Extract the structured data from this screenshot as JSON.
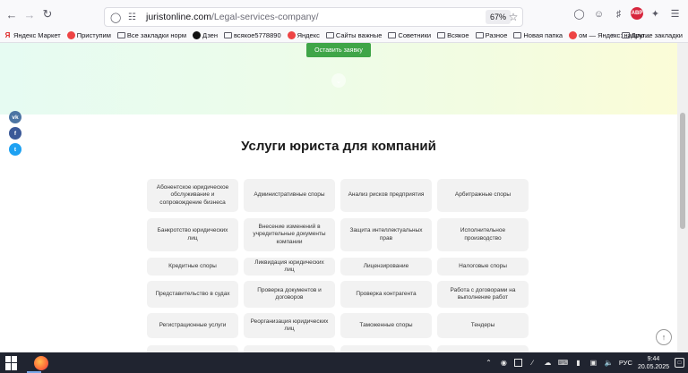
{
  "browser": {
    "url_domain": "juristonline.com",
    "url_path": "/Legal-services-company/",
    "zoom": "67%"
  },
  "bookmarks": {
    "items": [
      {
        "label": "Яндекс Маркет",
        "icon": "ya"
      },
      {
        "label": "Приступим",
        "icon": "red"
      },
      {
        "label": "Все закладки норм",
        "icon": "folder"
      },
      {
        "label": "Дзен",
        "icon": "dzen"
      },
      {
        "label": "всякое5778890",
        "icon": "folder"
      },
      {
        "label": "Яндекс",
        "icon": "red"
      },
      {
        "label": "Сайты важные",
        "icon": "folder"
      },
      {
        "label": "Советники",
        "icon": "folder"
      },
      {
        "label": "Всякое",
        "icon": "folder"
      },
      {
        "label": "Разное",
        "icon": "folder"
      },
      {
        "label": "Новая папка",
        "icon": "folder"
      },
      {
        "label": "ом — Яндекс: нашло...",
        "icon": "red"
      }
    ],
    "other": "Другие закладки"
  },
  "hero": {
    "cta_label": "Оставить заявку"
  },
  "social": {
    "vk": "vk",
    "fb": "f",
    "tw": "t"
  },
  "section": {
    "title": "Услуги юриста для компаний"
  },
  "services": [
    "Абонентское юридическое обслуживание и сопровождение бизнеса",
    "Административные споры",
    "Анализ рисков предприятия",
    "Арбитражные споры",
    "Банкротство юридических лиц",
    "Внесение изменений в учредительные документы компании",
    "Защита интеллектуальных прав",
    "Исполнительное производство",
    "Кредитные споры",
    "Ликвидация юридических лиц",
    "Лицензирование",
    "Налоговые споры",
    "Представительство в судах",
    "Проверка документов и договоров",
    "Проверка контрагента",
    "Работа с договорами на выполнение работ",
    "Регистрационные услуги",
    "Реорганизация юридических лиц",
    "Таможенные споры",
    "Тендеры"
  ],
  "taskbar": {
    "lang": "РУС",
    "time": "9:44",
    "date": "20.05.2025"
  }
}
